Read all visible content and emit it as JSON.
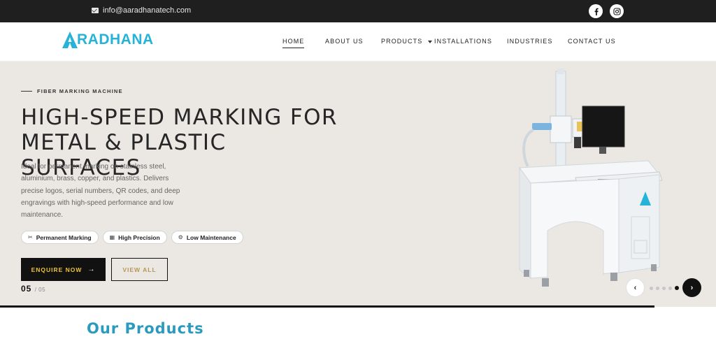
{
  "topbar": {
    "email": "info@aaradhanatech.com",
    "social": [
      {
        "icon": "facebook-icon",
        "glyph": "f"
      },
      {
        "icon": "instagram-icon",
        "glyph": "◎"
      }
    ]
  },
  "header": {
    "logo_text": "RADHANA",
    "nav": [
      {
        "label": "HOME",
        "active": true
      },
      {
        "label": "ABOUT US",
        "active": false
      },
      {
        "label": "PRODUCTS",
        "active": false,
        "has_dropdown": true
      },
      {
        "label": "INSTALLATIONS",
        "active": false
      },
      {
        "label": "INDUSTRIES",
        "active": false
      },
      {
        "label": "CONTACT US",
        "active": false
      }
    ]
  },
  "hero": {
    "eyebrow": "FIBER MARKING MACHINE",
    "title_line1": "HIGH-SPEED MARKING FOR",
    "title_line2": "METAL & PLASTIC SURFACES",
    "description": "Ideal for permanent marking on stainless steel, aluminium, brass, copper, and plastics. Delivers precise logos, serial numbers, QR codes, and deep engravings with high-speed performance and low maintenance.",
    "tags": [
      {
        "label": "Permanent Marking",
        "icon": "scissors-icon",
        "glyph": "✂"
      },
      {
        "label": "High Precision",
        "icon": "grid-icon",
        "glyph": "▦"
      },
      {
        "label": "Low Maintenance",
        "icon": "gear-icon",
        "glyph": "⚙"
      }
    ],
    "enquire_label": "ENQUIRE NOW",
    "enquire_arrow": "→",
    "view_all_label": "VIEW ALL",
    "slide_current": "05",
    "slide_total": "/ 05",
    "prev_glyph": "‹",
    "next_glyph": "›",
    "dots_total": 5,
    "dots_active": 5
  },
  "section": {
    "title": "Our Products"
  },
  "colors": {
    "accent": "#25b4d8",
    "dark": "#111111",
    "hero_bg": "#ebe8e3",
    "gold": "#f1c232"
  }
}
